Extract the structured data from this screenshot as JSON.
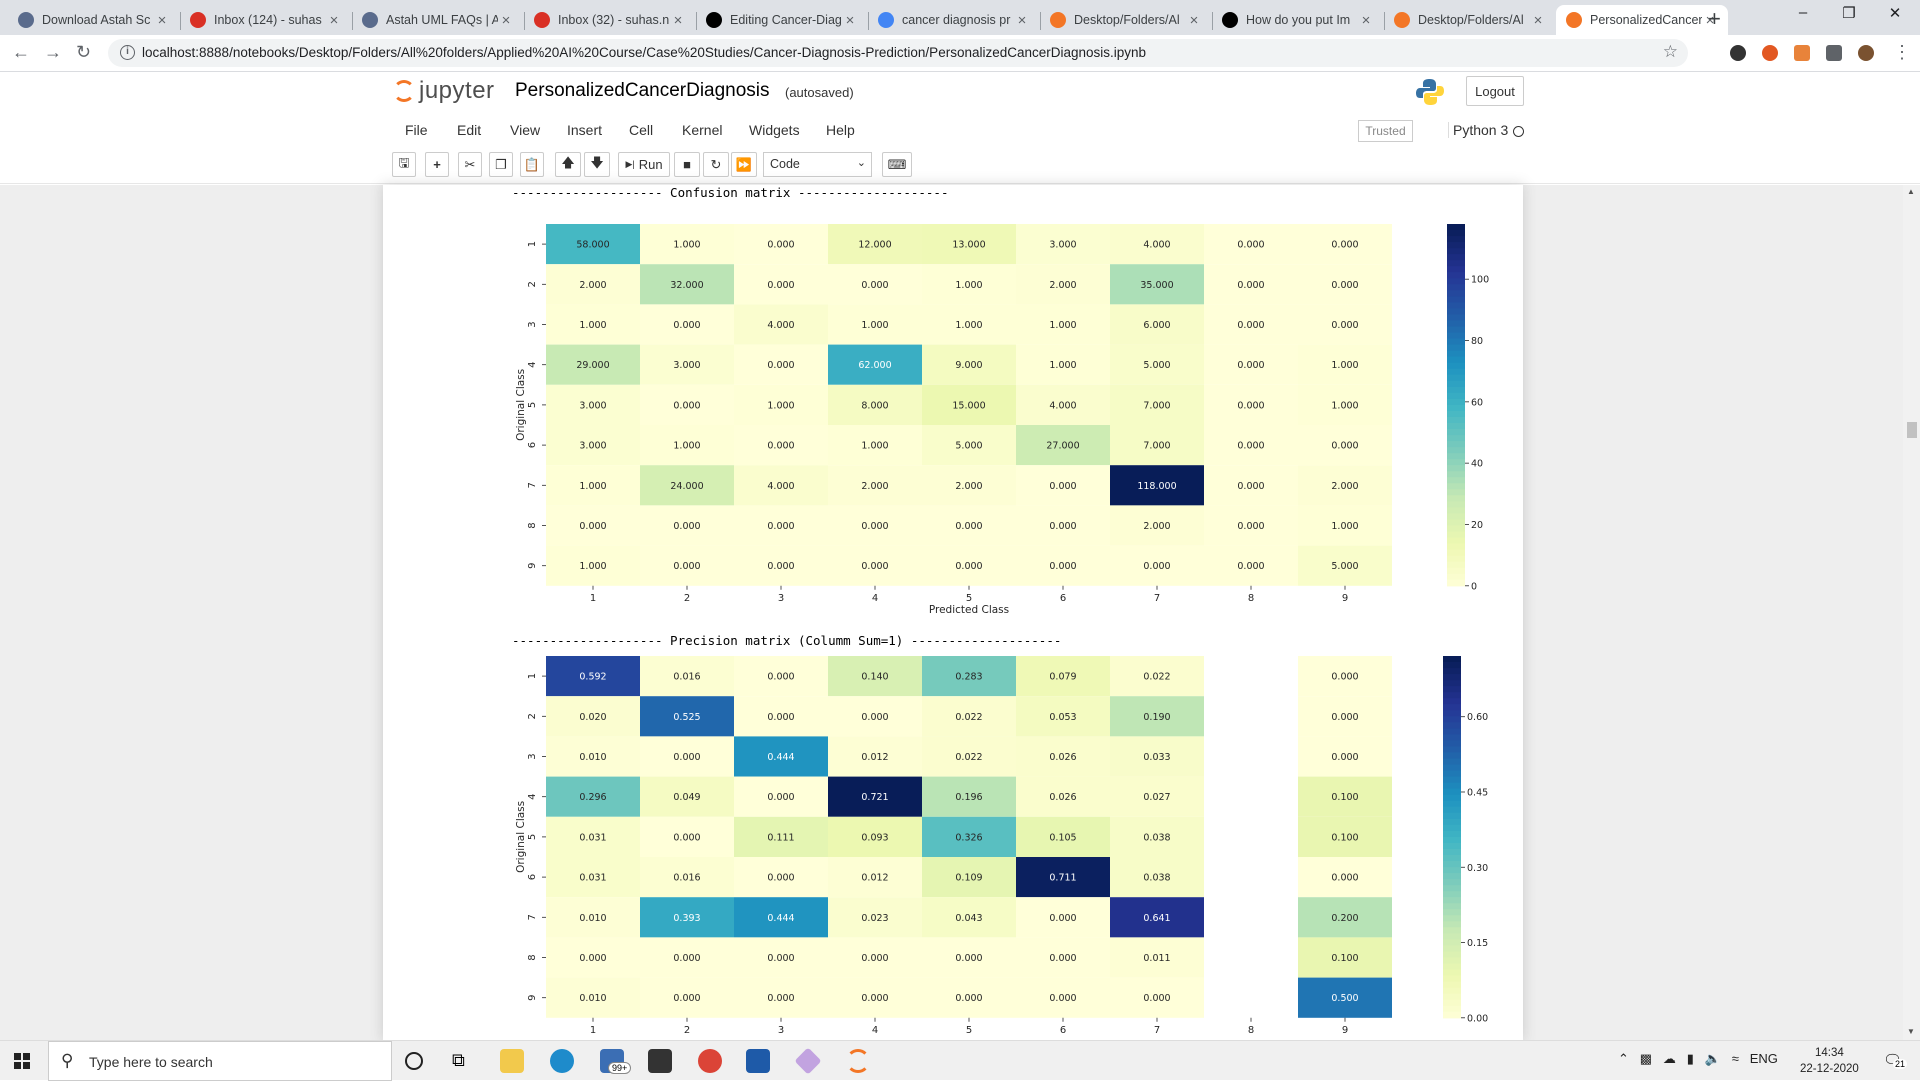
{
  "browser": {
    "tabs": [
      {
        "title": "Download Astah Sc",
        "favicon": "astah-icon",
        "color": "#5a6b8c"
      },
      {
        "title": "Inbox (124) - suhas",
        "favicon": "gmail-icon",
        "color": "#d93025"
      },
      {
        "title": "Astah UML FAQs | A",
        "favicon": "astah-icon",
        "color": "#5a6b8c"
      },
      {
        "title": "Inbox (32) - suhas.n",
        "favicon": "gmail-icon",
        "color": "#d93025"
      },
      {
        "title": "Editing Cancer-Diag",
        "favicon": "github-icon",
        "color": "#000000"
      },
      {
        "title": "cancer diagnosis pr",
        "favicon": "google-icon",
        "color": "#4285f4"
      },
      {
        "title": "Desktop/Folders/Al",
        "favicon": "jupyter-icon",
        "color": "#f37626"
      },
      {
        "title": "How do you put Im",
        "favicon": "github-icon",
        "color": "#000000"
      },
      {
        "title": "Desktop/Folders/Al",
        "favicon": "jupyter-icon",
        "color": "#f37626"
      },
      {
        "title": "PersonalizedCancer",
        "favicon": "notebook-icon",
        "color": "#f37626",
        "active": true
      }
    ],
    "url": "localhost:8888/notebooks/Desktop/Folders/All%20folders/Applied%20AI%20Course/Case%20Studies/Cancer-Diagnosis-Prediction/PersonalizedCancerDiagnosis.ipynb"
  },
  "jupyter": {
    "logo_text": "jupyter",
    "notebook_name": "PersonalizedCancerDiagnosis",
    "autosave_status": "(autosaved)",
    "logout_label": "Logout",
    "menu": [
      "File",
      "Edit",
      "View",
      "Insert",
      "Cell",
      "Kernel",
      "Widgets",
      "Help"
    ],
    "trusted_label": "Trusted",
    "kernel_name": "Python 3",
    "run_label": "Run",
    "cell_type": "Code"
  },
  "output": {
    "confusion_header": "-------------------- Confusion matrix --------------------",
    "precision_header": "-------------------- Precision matrix (Columm Sum=1) --------------------"
  },
  "chart_data": [
    {
      "type": "heatmap",
      "title": "Confusion matrix",
      "xlabel": "Predicted Class",
      "ylabel": "Original Class",
      "x_categories": [
        "1",
        "2",
        "3",
        "4",
        "5",
        "6",
        "7",
        "8",
        "9"
      ],
      "y_categories": [
        "1",
        "2",
        "3",
        "4",
        "5",
        "6",
        "7",
        "8",
        "9"
      ],
      "values": [
        [
          58,
          1,
          0,
          12,
          13,
          3,
          4,
          0,
          0
        ],
        [
          2,
          32,
          0,
          0,
          1,
          2,
          35,
          0,
          0
        ],
        [
          1,
          0,
          4,
          1,
          1,
          1,
          6,
          0,
          0
        ],
        [
          29,
          3,
          0,
          62,
          9,
          1,
          5,
          0,
          1
        ],
        [
          3,
          0,
          1,
          8,
          15,
          4,
          7,
          0,
          1
        ],
        [
          3,
          1,
          0,
          1,
          5,
          27,
          7,
          0,
          0
        ],
        [
          1,
          24,
          4,
          2,
          2,
          0,
          118,
          0,
          2
        ],
        [
          0,
          0,
          0,
          0,
          0,
          0,
          2,
          0,
          1
        ],
        [
          1,
          0,
          0,
          0,
          0,
          0,
          0,
          0,
          5
        ]
      ],
      "colormap": "YlGnBu",
      "value_format": "3 decimals",
      "colorbar_range": [
        0,
        118
      ],
      "colorbar_ticks": [
        0,
        20,
        40,
        60,
        80,
        100
      ]
    },
    {
      "type": "heatmap",
      "title": "Precision matrix (Columm Sum=1)",
      "ylabel": "Original Class",
      "x_categories": [
        "1",
        "2",
        "3",
        "4",
        "5",
        "6",
        "7",
        "8",
        "9"
      ],
      "y_categories": [
        "1",
        "2",
        "3",
        "4",
        "5",
        "6",
        "7",
        "8",
        "9"
      ],
      "values": [
        [
          0.592,
          0.016,
          0.0,
          0.14,
          0.283,
          0.079,
          0.022,
          null,
          0.0
        ],
        [
          0.02,
          0.525,
          0.0,
          0.0,
          0.022,
          0.053,
          0.19,
          null,
          0.0
        ],
        [
          0.01,
          0.0,
          0.444,
          0.012,
          0.022,
          0.026,
          0.033,
          null,
          0.0
        ],
        [
          0.296,
          0.049,
          0.0,
          0.721,
          0.196,
          0.026,
          0.027,
          null,
          0.1
        ],
        [
          0.031,
          0.0,
          0.111,
          0.093,
          0.326,
          0.105,
          0.038,
          null,
          0.1
        ],
        [
          0.031,
          0.016,
          0.0,
          0.012,
          0.109,
          0.711,
          0.038,
          null,
          0.0
        ],
        [
          0.01,
          0.393,
          0.444,
          0.023,
          0.043,
          0.0,
          0.641,
          null,
          0.2
        ],
        [
          0.0,
          0.0,
          0.0,
          0.0,
          0.0,
          0.0,
          0.011,
          null,
          0.1
        ],
        [
          0.01,
          0.0,
          0.0,
          0.0,
          0.0,
          0.0,
          0.0,
          null,
          0.5
        ]
      ],
      "colormap": "YlGnBu",
      "value_format": "3 decimals",
      "colorbar_range": [
        0,
        0.721
      ],
      "colorbar_ticks": [
        "0.00",
        "0.15",
        "0.30",
        "0.45",
        "0.60"
      ]
    }
  ],
  "taskbar": {
    "search_placeholder": "Type here to search",
    "notification_badge": "99+",
    "language": "ENG",
    "time": "14:34",
    "date": "22-12-2020",
    "notification_count": "21"
  }
}
